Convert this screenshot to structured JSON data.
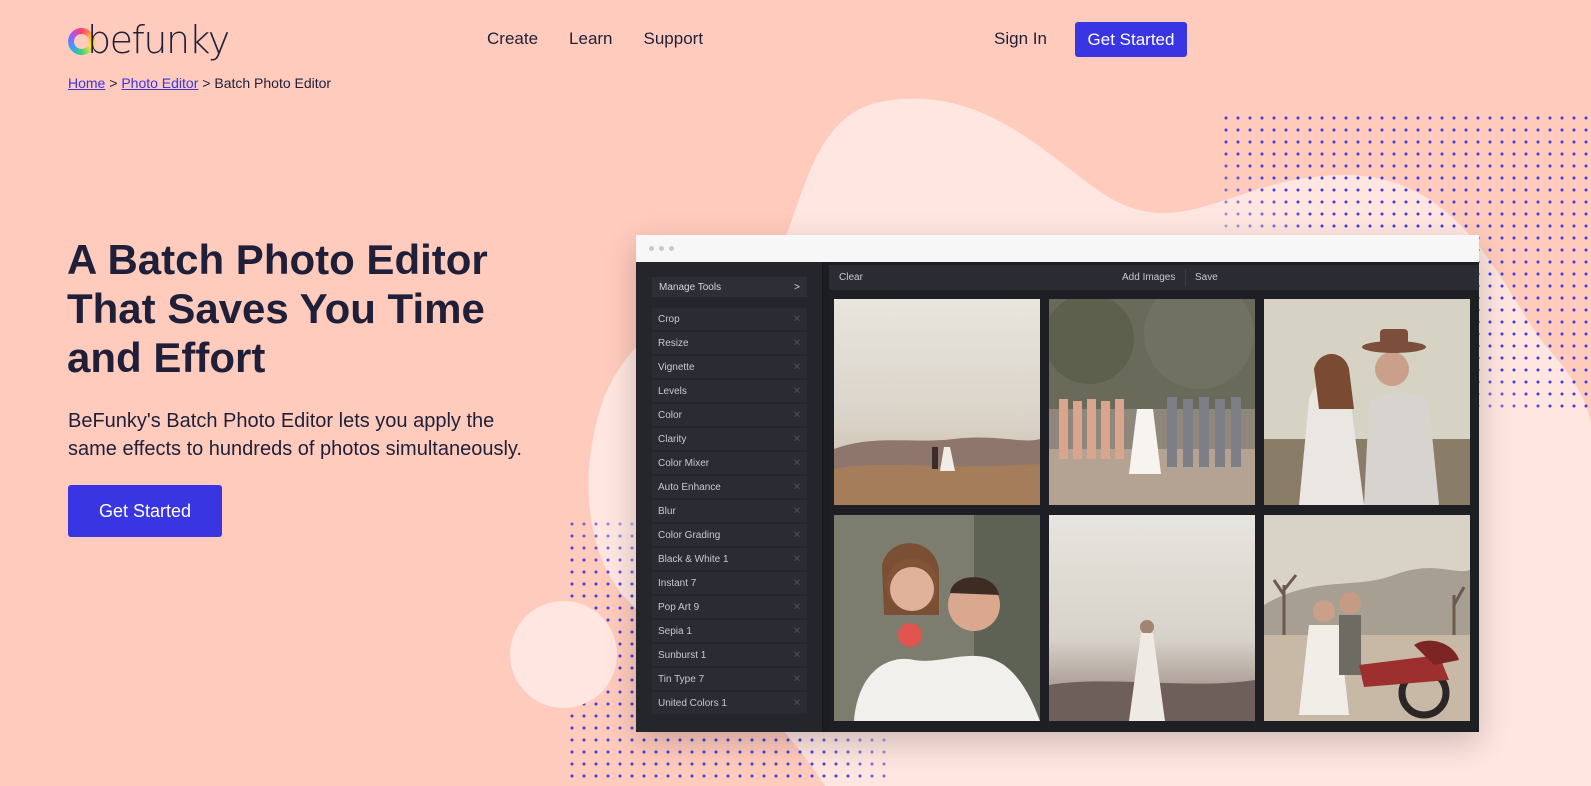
{
  "brand": {
    "logo_text": "befunky"
  },
  "nav": {
    "items": [
      "Create",
      "Learn",
      "Support"
    ]
  },
  "header": {
    "sign_in": "Sign In",
    "cta": "Get Started"
  },
  "breadcrumb": {
    "home": "Home",
    "sep1": " > ",
    "photo_editor": "Photo Editor",
    "sep2": " > ",
    "current": "Batch Photo Editor"
  },
  "hero": {
    "title": "A Batch Photo Editor That Saves You Time and Effort",
    "subtitle": "BeFunky's Batch Photo Editor lets you apply the same effects to hundreds of photos simultaneously.",
    "cta": "Get Started"
  },
  "editor": {
    "manage_tools": "Manage Tools",
    "manage_chevron": ">",
    "tool_remove_glyph": "✕",
    "tools": [
      "Crop",
      "Resize",
      "Vignette",
      "Levels",
      "Color",
      "Clarity",
      "Color Mixer",
      "Auto Enhance",
      "Blur",
      "Color Grading",
      "Black & White 1",
      "Instant 7",
      "Pop Art 9",
      "Sepia 1",
      "Sunburst 1",
      "Tin Type 7",
      "United Colors 1"
    ],
    "toolbar": {
      "clear": "Clear",
      "add_images": "Add Images",
      "save": "Save"
    },
    "photos": [
      "photo-couple-hills",
      "photo-wedding-party",
      "photo-couple-hat",
      "photo-piggyback-couple",
      "photo-bride-fog",
      "photo-couple-motorcycle"
    ]
  },
  "colors": {
    "background": "#ffcbbd",
    "accent": "#3a35e2",
    "blob": "#ffe6e0",
    "heading": "#1f1f3a",
    "editor_dark": "#1c1d22"
  }
}
